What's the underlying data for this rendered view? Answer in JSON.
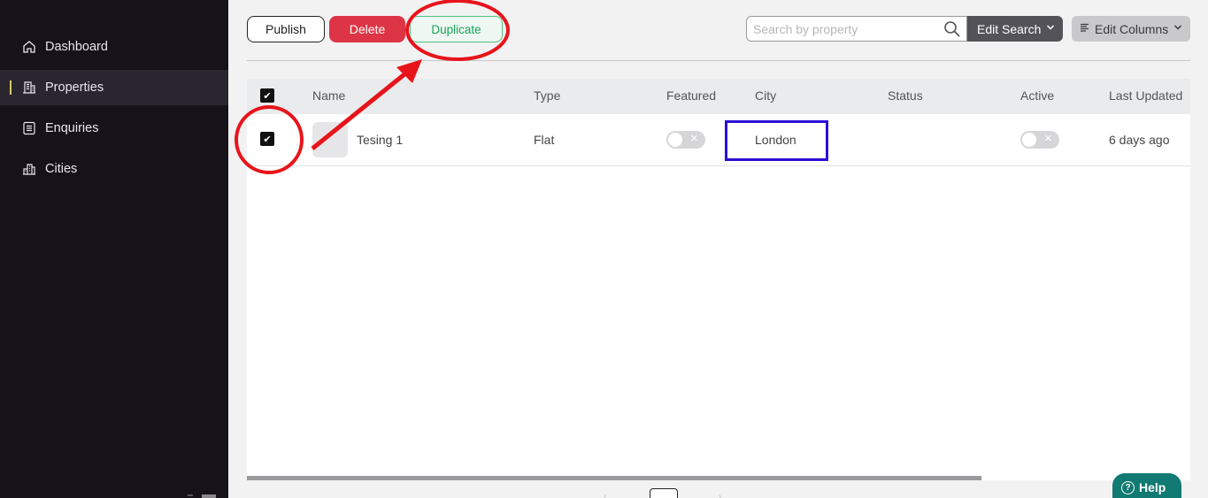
{
  "sidebar": {
    "items": [
      {
        "label": "Dashboard",
        "icon": "home-icon"
      },
      {
        "label": "Properties",
        "icon": "building-icon",
        "active": true
      },
      {
        "label": "Enquiries",
        "icon": "list-icon"
      },
      {
        "label": "Cities",
        "icon": "city-icon"
      }
    ]
  },
  "toolbar": {
    "publish_label": "Publish",
    "delete_label": "Delete",
    "duplicate_label": "Duplicate",
    "search_placeholder": "Search by property",
    "search_value": "",
    "edit_search_label": "Edit Search",
    "edit_columns_label": "Edit Columns"
  },
  "table": {
    "columns": [
      "Name",
      "Type",
      "Featured",
      "City",
      "Status",
      "Active",
      "Last Updated"
    ],
    "rows": [
      {
        "selected": true,
        "name": "Tesing 1",
        "type": "Flat",
        "featured": false,
        "city": "London",
        "status": "",
        "active": false,
        "last_updated": "6 days ago"
      }
    ]
  },
  "help_label": "Help",
  "colors": {
    "sidebar_bg": "#16121a",
    "delete": "#dd3545",
    "duplicate": "#1aa55a",
    "annotation_red": "#e8141b",
    "annotation_blue": "#2a0fd6",
    "help_bg": "#117a72"
  }
}
